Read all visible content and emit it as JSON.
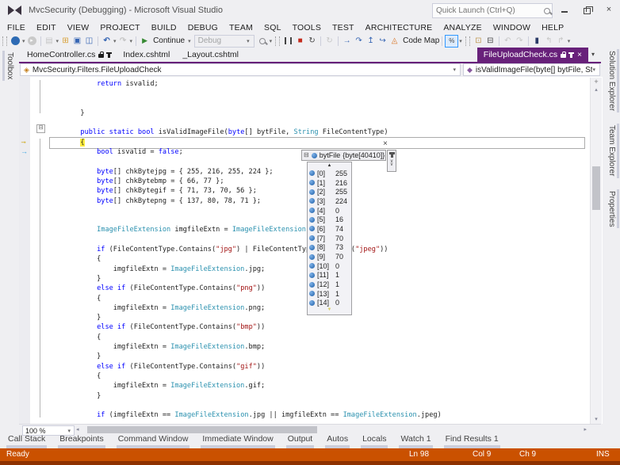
{
  "title_bar": {
    "title": "MvcSecurity (Debugging) - Microsoft Visual Studio",
    "quick_launch_placeholder": "Quick Launch (Ctrl+Q)"
  },
  "menu": [
    "FILE",
    "EDIT",
    "VIEW",
    "PROJECT",
    "BUILD",
    "DEBUG",
    "TEAM",
    "SQL",
    "TOOLS",
    "TEST",
    "ARCHITECTURE",
    "ANALYZE",
    "WINDOW",
    "HELP"
  ],
  "toolbar": {
    "continue_label": "Continue",
    "debug_label": "Debug",
    "code_map_label": "Code Map"
  },
  "doc_tabs": [
    {
      "label": "HomeController.cs",
      "icons": [
        "lock",
        "pin"
      ],
      "active": false
    },
    {
      "label": "Index.cshtml",
      "icons": [],
      "active": false
    },
    {
      "label": "_Layout.cshtml",
      "icons": [],
      "active": false
    },
    {
      "label": "FileUploadCheck.cs",
      "icons": [
        "lock",
        "pin",
        "close"
      ],
      "active": true
    }
  ],
  "nav_bar": {
    "type_dropdown": "MvcSecurity.Filters.FileUploadCheck",
    "member_dropdown": "isValidImageFile(byte[] bytFile, String FileContentType)"
  },
  "editor": {
    "zoom_level": "100 %",
    "code_lines": [
      [
        [
          "            ",
          "p"
        ],
        [
          "return",
          "k"
        ],
        [
          " isvalid;",
          "p"
        ]
      ],
      [],
      [],
      [
        [
          "        }",
          "p"
        ]
      ],
      [],
      [
        [
          "        ",
          "p"
        ],
        [
          "public",
          "k"
        ],
        [
          " ",
          "p"
        ],
        [
          "static",
          "k"
        ],
        [
          " ",
          "p"
        ],
        [
          "bool",
          "k"
        ],
        [
          " isValidImageFile(",
          "p"
        ],
        [
          "byte",
          "k"
        ],
        [
          "[] bytFile, ",
          "p"
        ],
        [
          "String",
          "y"
        ],
        [
          " FileContentType)",
          "p"
        ]
      ],
      [
        [
          "        ",
          "p"
        ],
        [
          "{",
          "cur"
        ]
      ],
      [
        [
          "            ",
          "p"
        ],
        [
          "bool",
          "k"
        ],
        [
          " isvalid = ",
          "p"
        ],
        [
          "false",
          "k"
        ],
        [
          ";",
          "p"
        ]
      ],
      [],
      [
        [
          "            ",
          "p"
        ],
        [
          "byte",
          "k"
        ],
        [
          "[] chkBytejpg = { 255, 216, 255, 224 };",
          "p"
        ]
      ],
      [
        [
          "            ",
          "p"
        ],
        [
          "byte",
          "k"
        ],
        [
          "[] chkBytebmp = { 66, 77 };",
          "p"
        ]
      ],
      [
        [
          "            ",
          "p"
        ],
        [
          "byte",
          "k"
        ],
        [
          "[] chkBytegif = { 71, 73, 70, 56 };",
          "p"
        ]
      ],
      [
        [
          "            ",
          "p"
        ],
        [
          "byte",
          "k"
        ],
        [
          "[] chkBytepng = { 137, 80, 78, 71 };",
          "p"
        ]
      ],
      [],
      [],
      [
        [
          "            ",
          "p"
        ],
        [
          "ImageFileExtension",
          "y"
        ],
        [
          " imgfileExtn = ",
          "p"
        ],
        [
          "ImageFileExtension",
          "y"
        ]
      ],
      [],
      [
        [
          "            ",
          "p"
        ],
        [
          "if",
          "k"
        ],
        [
          " (FileContentType.Contains(",
          "p"
        ],
        [
          "\"jpg\"",
          "s"
        ],
        [
          ") | FileContentType.Contains(",
          "p"
        ],
        [
          "\"jpeg\"",
          "s"
        ],
        [
          "))",
          "p"
        ]
      ],
      [
        [
          "            {",
          "p"
        ]
      ],
      [
        [
          "                imgfileExtn = ",
          "p"
        ],
        [
          "ImageFileExtension",
          "y"
        ],
        [
          ".jpg;",
          "p"
        ]
      ],
      [
        [
          "            }",
          "p"
        ]
      ],
      [
        [
          "            ",
          "p"
        ],
        [
          "else",
          "k"
        ],
        [
          " ",
          "p"
        ],
        [
          "if",
          "k"
        ],
        [
          " (FileContentType.Contains(",
          "p"
        ],
        [
          "\"png\"",
          "s"
        ],
        [
          "))",
          "p"
        ]
      ],
      [
        [
          "            {",
          "p"
        ]
      ],
      [
        [
          "                imgfileExtn = ",
          "p"
        ],
        [
          "ImageFileExtension",
          "y"
        ],
        [
          ".png;",
          "p"
        ]
      ],
      [
        [
          "            }",
          "p"
        ]
      ],
      [
        [
          "            ",
          "p"
        ],
        [
          "else",
          "k"
        ],
        [
          " ",
          "p"
        ],
        [
          "if",
          "k"
        ],
        [
          " (FileContentType.Contains(",
          "p"
        ],
        [
          "\"bmp\"",
          "s"
        ],
        [
          "))",
          "p"
        ]
      ],
      [
        [
          "            {",
          "p"
        ]
      ],
      [
        [
          "                imgfileExtn = ",
          "p"
        ],
        [
          "ImageFileExtension",
          "y"
        ],
        [
          ".bmp;",
          "p"
        ]
      ],
      [
        [
          "            }",
          "p"
        ]
      ],
      [
        [
          "            ",
          "p"
        ],
        [
          "else",
          "k"
        ],
        [
          " ",
          "p"
        ],
        [
          "if",
          "k"
        ],
        [
          " (FileContentType.Contains(",
          "p"
        ],
        [
          "\"gif\"",
          "s"
        ],
        [
          "))",
          "p"
        ]
      ],
      [
        [
          "            {",
          "p"
        ]
      ],
      [
        [
          "                imgfileExtn = ",
          "p"
        ],
        [
          "ImageFileExtension",
          "y"
        ],
        [
          ".gif;",
          "p"
        ]
      ],
      [
        [
          "            }",
          "p"
        ]
      ],
      [],
      [
        [
          "            ",
          "p"
        ],
        [
          "if",
          "k"
        ],
        [
          " (imgfileExtn == ",
          "p"
        ],
        [
          "ImageFileExtension",
          "y"
        ],
        [
          ".jpg || imgfileExtn == ",
          "p"
        ],
        [
          "ImageFileExtension",
          "y"
        ],
        [
          ".jpeg)",
          "p"
        ]
      ]
    ]
  },
  "datatip": {
    "name": "bytFile",
    "value": "{byte[40410]}",
    "rows": [
      {
        "index": "[0]",
        "value": "255"
      },
      {
        "index": "[1]",
        "value": "216"
      },
      {
        "index": "[2]",
        "value": "255"
      },
      {
        "index": "[3]",
        "value": "224"
      },
      {
        "index": "[4]",
        "value": "0"
      },
      {
        "index": "[5]",
        "value": "16"
      },
      {
        "index": "[6]",
        "value": "74"
      },
      {
        "index": "[7]",
        "value": "70"
      },
      {
        "index": "[8]",
        "value": "73"
      },
      {
        "index": "[9]",
        "value": "70"
      },
      {
        "index": "[10]",
        "value": "0"
      },
      {
        "index": "[11]",
        "value": "1"
      },
      {
        "index": "[12]",
        "value": "1"
      },
      {
        "index": "[13]",
        "value": "1"
      },
      {
        "index": "[14]",
        "value": "0"
      }
    ]
  },
  "side_tabs": {
    "left": [
      "Toolbox"
    ],
    "right": [
      "Solution Explorer",
      "Team Explorer",
      "Properties"
    ]
  },
  "bottom_tabs": [
    "Call Stack",
    "Breakpoints",
    "Command Window",
    "Immediate Window",
    "Output",
    "Autos",
    "Locals",
    "Watch 1",
    "Find Results 1"
  ],
  "status_bar": {
    "state": "Ready",
    "line": "Ln 98",
    "col": "Col 9",
    "ch": "Ch 9",
    "mode": "INS"
  },
  "colors": {
    "status_bar": "#CA5100",
    "active_tab": "#68217A",
    "keyword": "#0000FF",
    "type": "#2B91AF",
    "string": "#A31515",
    "current_statement": "#FFEE3E"
  },
  "icons": {
    "back": "◂",
    "fwd": "▸",
    "caret": "▾",
    "open": "▤",
    "add": "⊞",
    "save": "▣",
    "saveall": "◫",
    "undo": "↶",
    "redo": "↷",
    "play": "▶",
    "stop": "■",
    "restart": "↻",
    "stepinto": "→",
    "stepover": "↷",
    "stepout": "↥",
    "runto": "↪",
    "codemap": "◬",
    "hex": "%",
    "outwin": "⊡",
    "immwin": "⊟",
    "bookmark": "▮",
    "bmprev": "↰",
    "bmnext": "↱",
    "up": "▴",
    "down": "▾",
    "left": "◂",
    "right": "▸",
    "plus": "+",
    "collapse": "⊟",
    "class": "◈",
    "method": "◆",
    "closex": "×",
    "scrollup": "▲",
    "scrolldown": "▼"
  }
}
